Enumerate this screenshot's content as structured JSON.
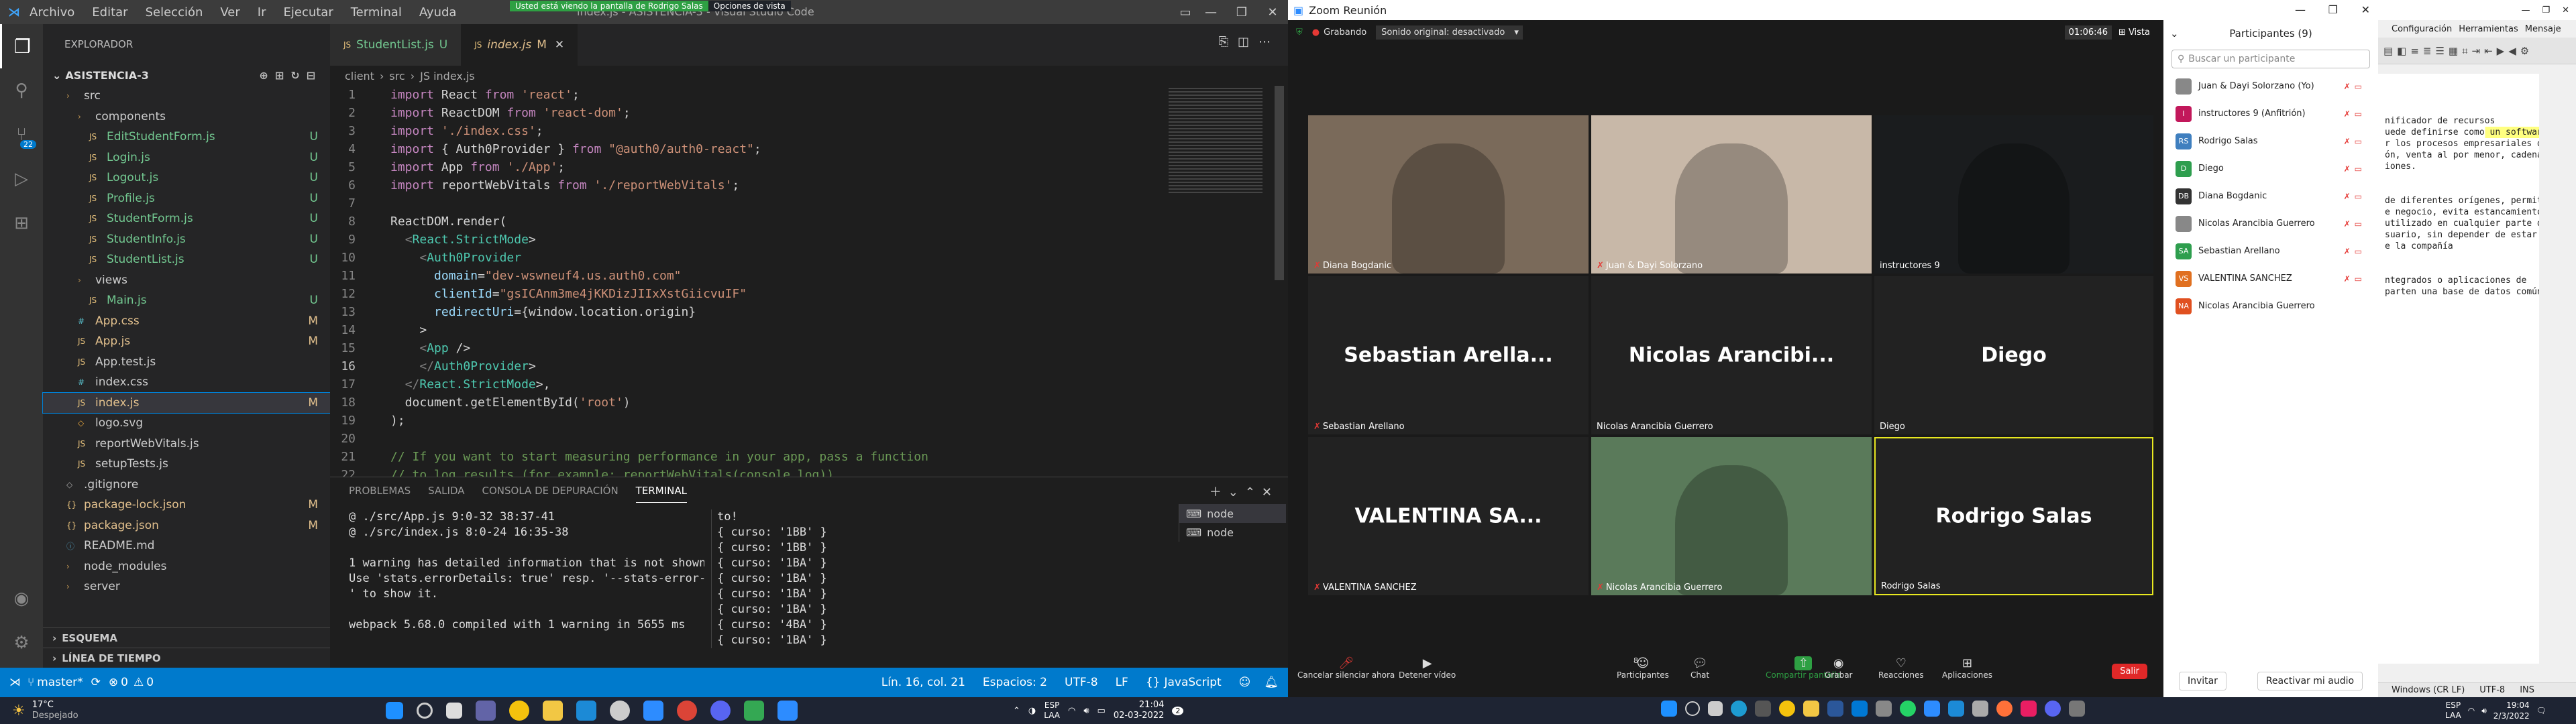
{
  "vscode": {
    "menu": [
      "Archivo",
      "Editar",
      "Selección",
      "Ver",
      "Ir",
      "Ejecutar",
      "Terminal",
      "Ayuda"
    ],
    "title": "index.js - ASISTENCIA-3 - Visual Studio Code",
    "share_banner": "Usted está viendo la pantalla de Rodrigo Salas",
    "share_options": "Opciones de vista",
    "explorer_title": "EXPLORADOR",
    "project": "ASISTENCIA-3",
    "tree": [
      {
        "label": "src",
        "indent": 1,
        "type": "folder",
        "status": ""
      },
      {
        "label": "components",
        "indent": 2,
        "type": "folder",
        "status": ""
      },
      {
        "label": "EditStudentForm.js",
        "indent": 3,
        "type": "js",
        "status": "U"
      },
      {
        "label": "Login.js",
        "indent": 3,
        "type": "js",
        "status": "U"
      },
      {
        "label": "Logout.js",
        "indent": 3,
        "type": "js",
        "status": "U"
      },
      {
        "label": "Profile.js",
        "indent": 3,
        "type": "js",
        "status": "U"
      },
      {
        "label": "StudentForm.js",
        "indent": 3,
        "type": "js",
        "status": "U"
      },
      {
        "label": "StudentInfo.js",
        "indent": 3,
        "type": "js",
        "status": "U"
      },
      {
        "label": "StudentList.js",
        "indent": 3,
        "type": "js",
        "status": "U"
      },
      {
        "label": "views",
        "indent": 2,
        "type": "folder",
        "status": ""
      },
      {
        "label": "Main.js",
        "indent": 3,
        "type": "js",
        "status": "U"
      },
      {
        "label": "App.css",
        "indent": 2,
        "type": "css",
        "status": "M"
      },
      {
        "label": "App.js",
        "indent": 2,
        "type": "js",
        "status": "M"
      },
      {
        "label": "App.test.js",
        "indent": 2,
        "type": "js",
        "status": ""
      },
      {
        "label": "index.css",
        "indent": 2,
        "type": "css",
        "status": ""
      },
      {
        "label": "index.js",
        "indent": 2,
        "type": "js",
        "status": "M"
      },
      {
        "label": "logo.svg",
        "indent": 2,
        "type": "svg",
        "status": ""
      },
      {
        "label": "reportWebVitals.js",
        "indent": 2,
        "type": "js",
        "status": ""
      },
      {
        "label": "setupTests.js",
        "indent": 2,
        "type": "js",
        "status": ""
      },
      {
        "label": ".gitignore",
        "indent": 1,
        "type": "file",
        "status": ""
      },
      {
        "label": "package-lock.json",
        "indent": 1,
        "type": "json",
        "status": "M"
      },
      {
        "label": "package.json",
        "indent": 1,
        "type": "json",
        "status": "M"
      },
      {
        "label": "README.md",
        "indent": 1,
        "type": "md",
        "status": ""
      },
      {
        "label": "node_modules",
        "indent": 1,
        "type": "folder",
        "status": ""
      },
      {
        "label": "server",
        "indent": 1,
        "type": "folder",
        "status": ""
      }
    ],
    "sections": [
      "ESQUEMA",
      "LÍNEA DE TIEMPO"
    ],
    "tabs": [
      {
        "label": "StudentList.js",
        "mark": "U"
      },
      {
        "label": "index.js",
        "mark": "M"
      }
    ],
    "breadcrumb": [
      "client",
      "src",
      "JS index.js"
    ],
    "code": [
      "import React from 'react';",
      "import ReactDOM from 'react-dom';",
      "import './index.css';",
      "import { Auth0Provider } from \"@auth0/auth0-react\";",
      "import App from './App';",
      "import reportWebVitals from './reportWebVitals';",
      "",
      "ReactDOM.render(",
      "  <React.StrictMode>",
      "    <Auth0Provider",
      "      domain=\"dev-wswneuf4.us.auth0.com\"",
      "      clientId=\"gsICAnm3me4jKKDizJIIxXstGiicvuIF\"",
      "      redirectUri={window.location.origin}",
      "    >",
      "    <App />",
      "    </Auth0Provider>",
      "  </React.StrictMode>,",
      "  document.getElementById('root')",
      ");",
      "",
      "// If you want to start measuring performance in your app, pass a function",
      "// to log results (for example: reportWebVitals(console.log))"
    ],
    "panel_tabs": [
      "PROBLEMAS",
      "SALIDA",
      "CONSOLA DE DEPURACIÓN",
      "TERMINAL"
    ],
    "terminal_left": [
      "@ ./src/App.js 9:0-32 38:37-41",
      "@ ./src/index.js 8:0-24 16:35-38",
      "",
      "1 warning has detailed information that is not shown.",
      "Use 'stats.errorDetails: true' resp. '--stats-error-details",
      "' to show it.",
      "",
      "webpack 5.68.0 compiled with 1 warning in 5655 ms"
    ],
    "terminal_right": [
      "to!",
      "{ curso: '1BB' }",
      "{ curso: '1BB' }",
      "{ curso: '1BA' }",
      "{ curso: '1BA' }",
      "{ curso: '1BA' }",
      "{ curso: '1BA' }",
      "{ curso: '4BA' }",
      "{ curso: '1BA' }"
    ],
    "terminals": [
      "node",
      "node"
    ],
    "status": {
      "branch": "master*",
      "errors": "0",
      "warnings": "0",
      "position": "Lín. 16, col. 21",
      "spaces": "Espacios: 2",
      "encoding": "UTF-8",
      "eol": "LF",
      "language": "JavaScript"
    }
  },
  "zoom": {
    "title": "Zoom Reunión",
    "recording": "Grabando",
    "audio": "Sonido original: desactivado",
    "timer": "01:06:46",
    "view": "Vista",
    "tiles": [
      {
        "name": "Diana Bogdanic",
        "big": "",
        "video": "#7a6a5a"
      },
      {
        "name": "Juan & Dayi Solorzano",
        "big": "",
        "video": "#c8b8a8"
      },
      {
        "name": "instructores 9",
        "big": "",
        "video": "#1a1c1e"
      },
      {
        "name": "Sebastian Arellano",
        "big": "Sebastian Arella...",
        "video": ""
      },
      {
        "name": "Nicolas Arancibia Guerrero",
        "big": "Nicolas Arancibi...",
        "video": ""
      },
      {
        "name": "Diego",
        "big": "Diego",
        "video": ""
      },
      {
        "name": "VALENTINA SANCHEZ",
        "big": "VALENTINA SA...",
        "video": ""
      },
      {
        "name": "Nicolas Arancibia Guerrero",
        "big": "",
        "video": "#5a7a5a"
      },
      {
        "name": "Rodrigo Salas",
        "big": "Rodrigo Salas",
        "video": ""
      }
    ],
    "controls": [
      "Cancelar silenciar ahora",
      "Detener vídeo",
      "Participantes",
      "Chat",
      "Compartir pantalla",
      "Grabar",
      "Reacciones",
      "Aplicaciones"
    ],
    "participants_count": "8",
    "leave": "Salir",
    "participants_title": "Participantes (9)",
    "search_placeholder": "Buscar un participante",
    "participants": [
      {
        "initials": "",
        "name": "Juan & Dayi Solorzano (Yo)",
        "color": "#888"
      },
      {
        "initials": "I",
        "name": "instructores 9 (Anfitrión)",
        "color": "#c2185b"
      },
      {
        "initials": "RS",
        "name": "Rodrigo Salas",
        "color": "#3f7fbf"
      },
      {
        "initials": "D",
        "name": "Diego",
        "color": "#2e9e4e"
      },
      {
        "initials": "DB",
        "name": "Diana Bogdanic",
        "color": "#333"
      },
      {
        "initials": "",
        "name": "Nicolas Arancibia Guerrero",
        "color": "#888"
      },
      {
        "initials": "SA",
        "name": "Sebastian Arellano",
        "color": "#2e9e4e"
      },
      {
        "initials": "VS",
        "name": "VALENTINA SANCHEZ",
        "color": "#e07020"
      },
      {
        "initials": "NA",
        "name": "Nicolas Arancibia Guerrero",
        "color": "#e05020"
      }
    ],
    "invite": "Invitar",
    "unmute": "Reactivar mi audio"
  },
  "doc": {
    "menu": [
      "Configuración",
      "Herramientas",
      "Mensaje"
    ],
    "lines": [
      "nificador de recursos",
      "uede definirse como un software",
      "r los procesos empresariales de",
      "ón, venta al por menor, cadena de",
      "iones.",
      "",
      "",
      "de diferentes orígenes, permite",
      "e negocio, evita estancamientos",
      "utilizado en cualquier parte del",
      "suario, sin depender de estar",
      "e la compañía",
      "",
      "",
      "ntegrados o aplicaciones de",
      "parten una base de datos común"
    ],
    "status": [
      "Windows (CR LF)",
      "UTF-8",
      "INS"
    ]
  },
  "taskbar": {
    "weather_temp": "17°C",
    "weather_desc": "Despejado",
    "lang_left": [
      "ESP",
      "LAA"
    ],
    "time_left": "21:04",
    "date_left": "02-03-2022",
    "lang_right": [
      "ESP",
      "LAA"
    ],
    "time_right": "19:04",
    "date_right": "2/3/2022"
  }
}
